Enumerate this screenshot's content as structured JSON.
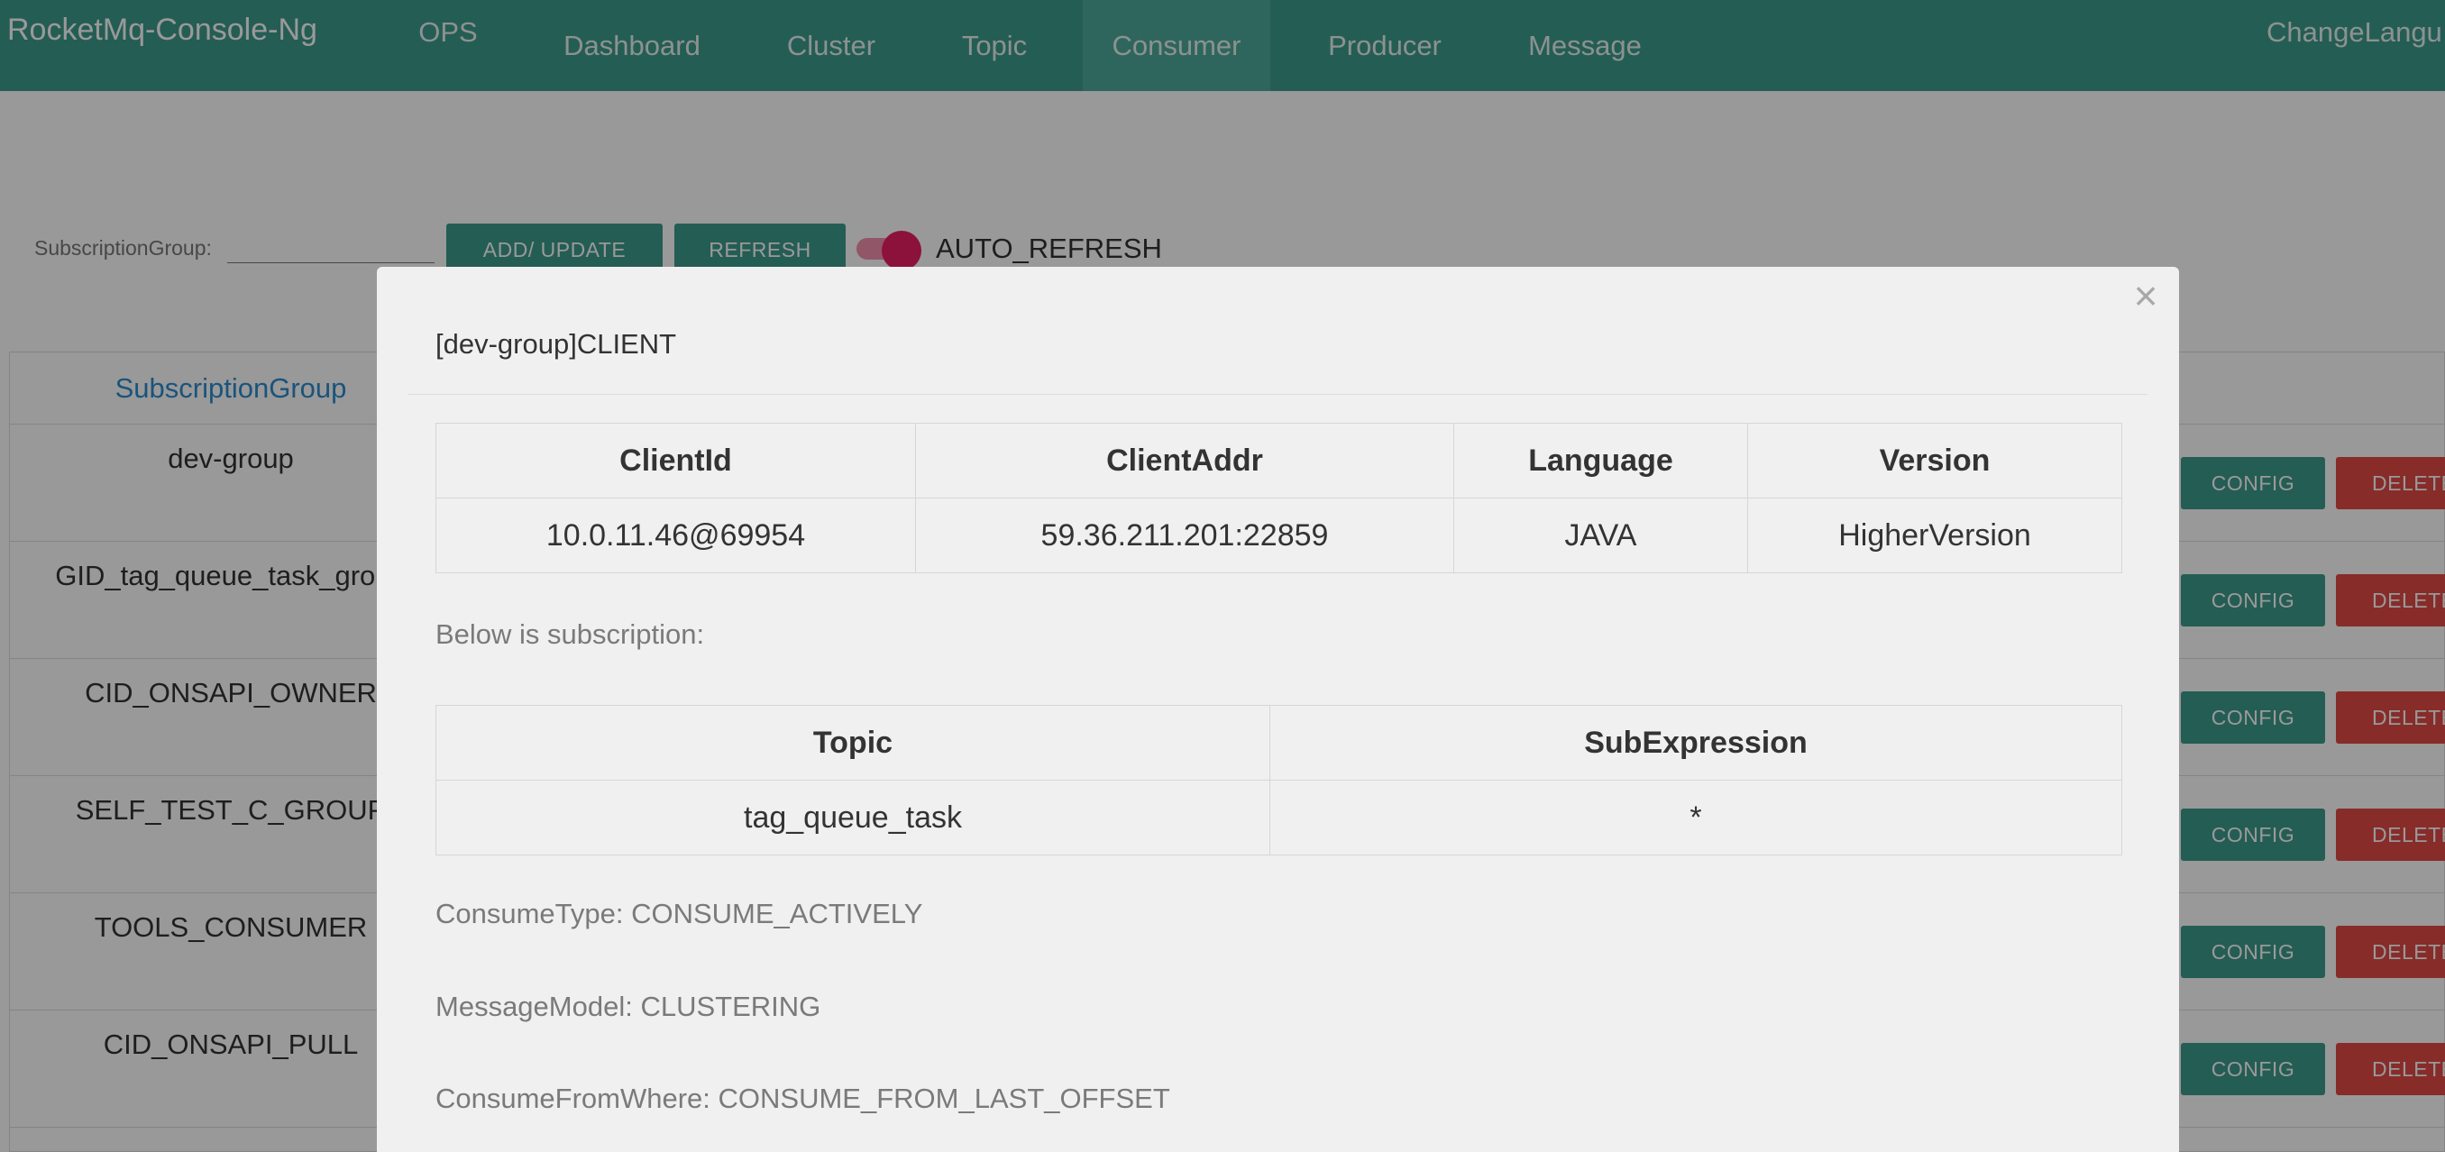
{
  "navbar": {
    "brand": "RocketMq-Console-Ng",
    "items": [
      "OPS",
      "Dashboard",
      "Cluster",
      "Topic",
      "Consumer",
      "Producer",
      "Message"
    ],
    "active": "Consumer",
    "change_language": "ChangeLangu"
  },
  "toolbar": {
    "filter_label": "SubscriptionGroup:",
    "add_update_label": "ADD/ UPDATE",
    "refresh_label": "REFRESH",
    "auto_refresh_label": "AUTO_REFRESH",
    "auto_refresh_on": true
  },
  "group_table": {
    "header": "SubscriptionGroup",
    "config_label": "CONFIG",
    "delete_label": "DELETE",
    "rows": [
      "dev-group",
      "GID_tag_queue_task_group",
      "CID_ONSAPI_OWNER",
      "SELF_TEST_C_GROUP",
      "TOOLS_CONSUMER",
      "CID_ONSAPI_PULL"
    ]
  },
  "modal": {
    "title": "[dev-group]CLIENT",
    "close_symbol": "×",
    "client_table": {
      "headers": [
        "ClientId",
        "ClientAddr",
        "Language",
        "Version"
      ],
      "rows": [
        [
          "10.0.11.46@69954",
          "59.36.211.201:22859",
          "JAVA",
          "HigherVersion"
        ]
      ]
    },
    "subscription_intro": "Below is subscription:",
    "subscription_table": {
      "headers": [
        "Topic",
        "SubExpression"
      ],
      "rows": [
        [
          "tag_queue_task",
          "*"
        ]
      ]
    },
    "consume_type": "ConsumeType: CONSUME_ACTIVELY",
    "message_model": "MessageModel: CLUSTERING",
    "consume_from_where": "ConsumeFromWhere: CONSUME_FROM_LAST_OFFSET"
  }
}
